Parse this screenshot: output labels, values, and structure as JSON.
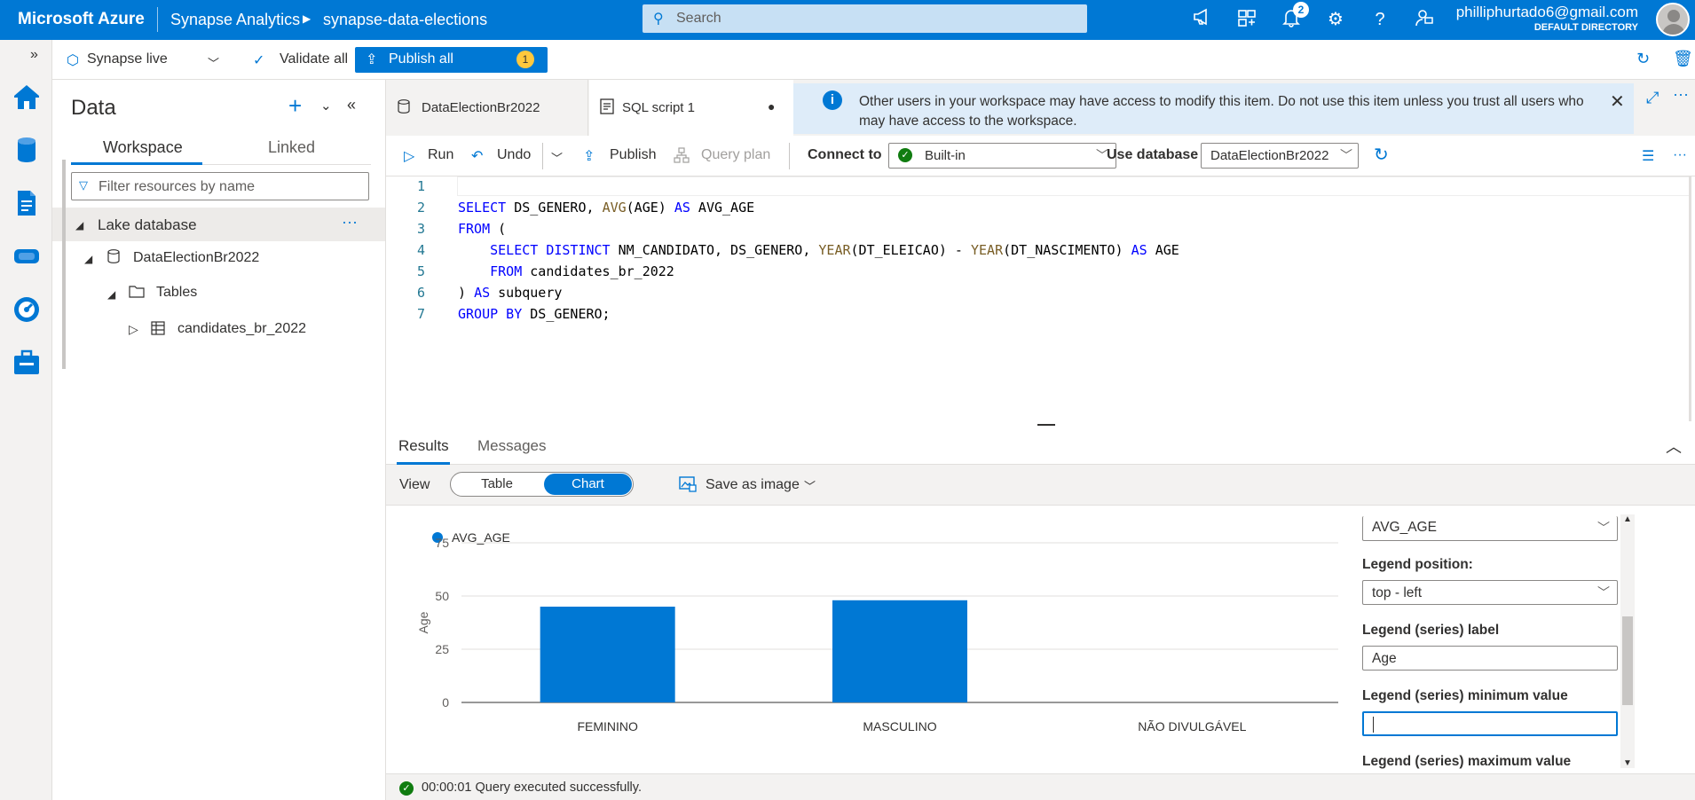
{
  "topbar": {
    "brand": "Microsoft Azure",
    "service": "Synapse Analytics",
    "workspace": "synapse-data-elections",
    "search_placeholder": "Search",
    "notifications_count": "2",
    "user_email": "philliphurtado6@gmail.com",
    "user_directory": "DEFAULT DIRECTORY"
  },
  "commandbar": {
    "synapse_live": "Synapse live",
    "validate_all": "Validate all",
    "publish_all": "Publish all",
    "publish_count": "1"
  },
  "data_panel": {
    "title": "Data",
    "tabs": [
      "Workspace",
      "Linked"
    ],
    "filter_placeholder": "Filter resources by name",
    "tree": {
      "lake_database": "Lake database",
      "database": "DataElectionBr2022",
      "tables_folder": "Tables",
      "table": "candidates_br_2022"
    }
  },
  "editor_tabs": [
    {
      "label": "DataElectionBr2022"
    },
    {
      "label": "SQL script 1",
      "unsaved_marker": "●"
    }
  ],
  "info_banner": {
    "message": "Other users in your workspace may have access to modify this item. Do not use this item unless you trust all users who may have access to the workspace."
  },
  "script_toolbar": {
    "run": "Run",
    "undo": "Undo",
    "publish": "Publish",
    "query_plan": "Query plan",
    "connect_to_label": "Connect to",
    "connect_to_value": "Built-in",
    "use_database_label": "Use database",
    "use_database_value": "DataElectionBr2022"
  },
  "code": {
    "line_numbers": [
      "1",
      "2",
      "3",
      "4",
      "5",
      "6",
      "7"
    ]
  },
  "results": {
    "tabs": [
      "Results",
      "Messages"
    ],
    "view_label": "View",
    "view_options": [
      "Table",
      "Chart"
    ],
    "view_selected": "Chart",
    "save_as_image": "Save as image"
  },
  "chart_data": {
    "type": "bar",
    "categories": [
      "FEMININO",
      "MASCULINO",
      "NÃO DIVULGÁVEL"
    ],
    "series": [
      {
        "name": "AVG_AGE",
        "values": [
          45,
          48,
          0
        ]
      }
    ],
    "ylabel": "Age",
    "xlabel": "",
    "ylim": [
      0,
      75
    ],
    "yticks": [
      0,
      25,
      50,
      75
    ],
    "legend_position": "top-left",
    "grid": true,
    "color": "#0078d4"
  },
  "chart_settings": {
    "series_field_value": "AVG_AGE",
    "legend_position_label": "Legend position:",
    "legend_position_value": "top - left",
    "legend_label_label": "Legend (series) label",
    "legend_label_value": "Age",
    "legend_min_label": "Legend (series) minimum value",
    "legend_min_value": "",
    "legend_max_label": "Legend (series) maximum value"
  },
  "status": {
    "text": "00:00:01 Query executed successfully."
  },
  "colors": {
    "accent": "#0078d4",
    "success": "#107c10",
    "badge": "#ffc83d"
  }
}
